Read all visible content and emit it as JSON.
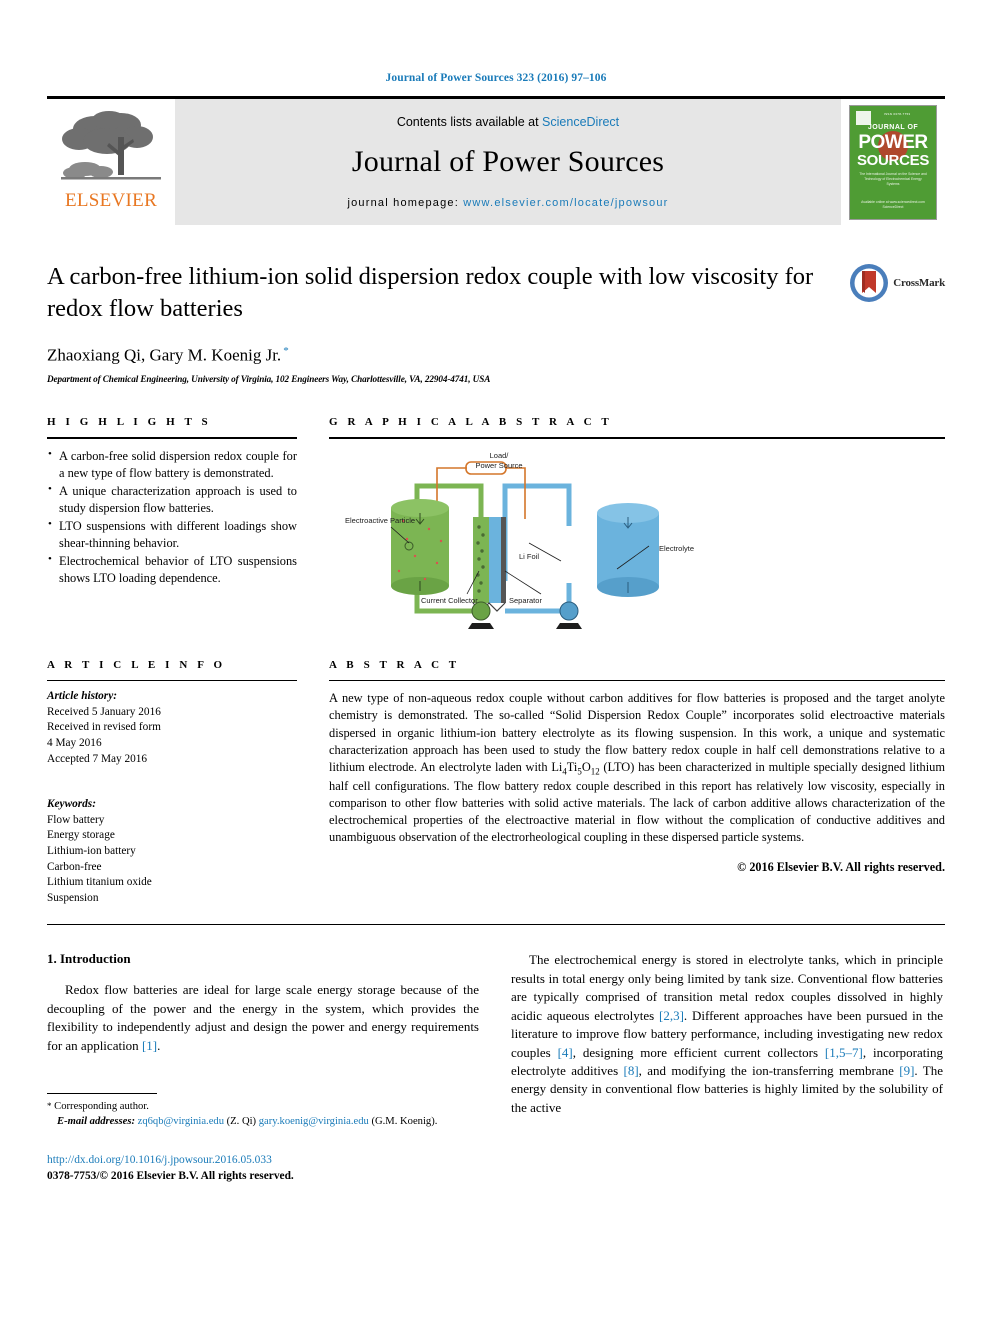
{
  "running_head": "Journal of Power Sources 323 (2016) 97–106",
  "masthead": {
    "contents_prefix": "Contents lists available at ",
    "sciencedirect": "ScienceDirect",
    "journal_name": "Journal of Power Sources",
    "homepage_prefix": "journal homepage: ",
    "homepage_url": "www.elsevier.com/locate/jpowsour",
    "publisher": "ELSEVIER",
    "cover": {
      "tiny_top": "ISSN 0378-7753",
      "line1": "JOURNAL OF",
      "line2": "POWER",
      "line3": "SOURCES",
      "subtitle": "The International Journal on the Science and Technology of Electrochemical Energy Systems",
      "footer": "Available online at www.sciencedirect.com\nScienceDirect"
    }
  },
  "article": {
    "title": "A carbon-free lithium-ion solid dispersion redox couple with low viscosity for redox flow batteries",
    "authors": "Zhaoxiang Qi, Gary M. Koenig Jr.",
    "corresponding_marker": "*",
    "affiliation": "Department of Chemical Engineering, University of Virginia, 102 Engineers Way, Charlottesville, VA, 22904-4741, USA",
    "crossmark_label": "CrossMark"
  },
  "highlights": {
    "heading": "H I G H L I G H T S",
    "items": [
      "A carbon-free solid dispersion redox couple for a new type of flow battery is demonstrated.",
      "A unique characterization approach is used to study dispersion flow batteries.",
      "LTO suspensions with different loadings show shear-thinning behavior.",
      "Electrochemical behavior of LTO suspensions shows LTO loading dependence."
    ]
  },
  "graphical_abstract": {
    "heading": "G R A P H I C A L   A B S T R A C T",
    "labels": {
      "load": "Load/",
      "power_source": "Power Source",
      "electroactive_particle": "Electroactive Particle",
      "li_foil": "Li Foil",
      "electrolyte": "Electrolyte",
      "current_collector": "Current Collector",
      "separator": "Separator"
    },
    "colors": {
      "anolyte_green": "#7cb553",
      "catholyte_blue": "#6bb3dd",
      "circuit_orange": "#d4762a",
      "separator_gray": "#555555"
    }
  },
  "article_info": {
    "heading": "A R T I C L E   I N F O",
    "history_label": "Article history:",
    "history": [
      "Received 5 January 2016",
      "Received in revised form",
      "4 May 2016",
      "Accepted 7 May 2016"
    ],
    "keywords_label": "Keywords:",
    "keywords": [
      "Flow battery",
      "Energy storage",
      "Lithium-ion battery",
      "Carbon-free",
      "Lithium titanium oxide",
      "Suspension"
    ]
  },
  "abstract": {
    "heading": "A B S T R A C T",
    "part1": "A new type of non-aqueous redox couple without carbon additives for flow batteries is proposed and the target anolyte chemistry is demonstrated. The so-called “Solid Dispersion Redox Couple” incorporates solid electroactive materials dispersed in organic lithium-ion battery electrolyte as its flowing suspension. In this work, a unique and systematic characterization approach has been used to study the flow battery redox couple in half cell demonstrations relative to a lithium electrode. An electrolyte laden with ",
    "formula_li": "Li",
    "formula_sub1": "4",
    "formula_ti": "Ti",
    "formula_sub2": "5",
    "formula_o": "O",
    "formula_sub3": "12",
    "part2": " (LTO) has been characterized in multiple specially designed lithium half cell configurations. The flow battery redox couple described in this report has relatively low viscosity, especially in comparison to other flow batteries with solid active materials. The lack of carbon additive allows characterization of the electrochemical properties of the electroactive material in flow without the complication of conductive additives and unambiguous observation of the electrorheological coupling in these dispersed particle systems.",
    "copyright": "© 2016 Elsevier B.V. All rights reserved."
  },
  "introduction": {
    "section_number_title": "1.  Introduction",
    "left_para": {
      "t1": "Redox flow batteries are ideal for large scale energy storage because of the decoupling of the power and the energy in the system, which provides the flexibility to independently adjust and design the power and energy requirements for an application ",
      "c1": "[1]",
      "t2": "."
    },
    "right_para": {
      "t1": "The electrochemical energy is stored in electrolyte tanks, which in principle results in total energy only being limited by tank size. Conventional flow batteries are typically comprised of transition metal redox couples dissolved in highly acidic aqueous electrolytes ",
      "c1": "[2,3]",
      "t2": ". Different approaches have been pursued in the literature to improve flow battery performance, including investigating new redox couples ",
      "c2": "[4]",
      "t3": ", designing more efficient current collectors ",
      "c3": "[1,5–7]",
      "t4": ", incorporating electrolyte additives ",
      "c4": "[8]",
      "t5": ", and modifying the ion-transferring membrane ",
      "c5": "[9]",
      "t6": ". The energy density in conventional flow batteries is highly limited by the solubility of the active"
    }
  },
  "footnotes": {
    "corresponding": "Corresponding author.",
    "corresponding_star": "*",
    "email_label": "E-mail addresses:",
    "email1": "zq6qb@virginia.edu",
    "email1_owner": "(Z. Qi)",
    "email2": "gary.koenig@virginia.edu",
    "email2_owner": "(G.M. Koenig).",
    "doi": "http://dx.doi.org/10.1016/j.jpowsour.2016.05.033",
    "issn": "0378-7753/© 2016 Elsevier B.V. All rights reserved."
  }
}
